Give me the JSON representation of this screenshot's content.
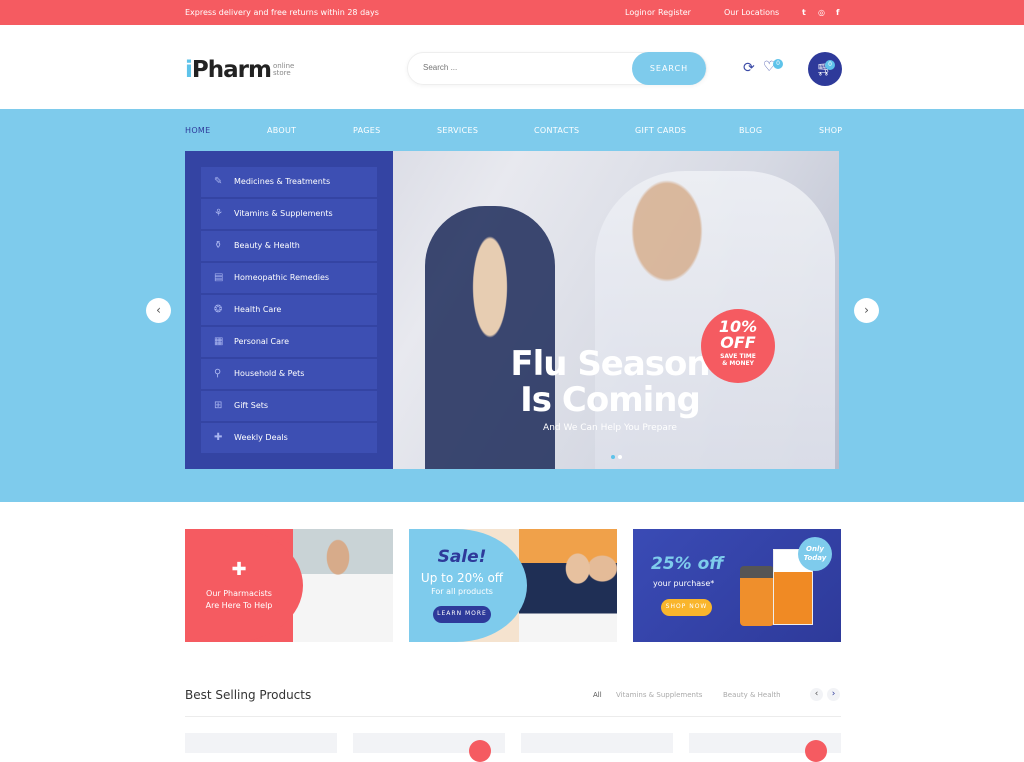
{
  "topbar": {
    "promo": "Express delivery and free returns within 28 days",
    "login": "Login",
    "or": "or",
    "register": "Register",
    "locations": "Our Locations",
    "social": [
      "twitter-icon",
      "instagram-icon",
      "facebook-icon"
    ]
  },
  "header": {
    "logo_i": "i",
    "logo_rest": "Pharm",
    "logo_sub1": "online",
    "logo_sub2": "store",
    "search_placeholder": "Search ...",
    "search_button": "SEARCH",
    "wishlist_count": "0",
    "cart_count": "0"
  },
  "nav": [
    "HOME",
    "ABOUT",
    "PAGES",
    "SERVICES",
    "CONTACTS",
    "GIFT CARDS",
    "BLOG",
    "SHOP"
  ],
  "categories": [
    "Medicines & Treatments",
    "Vitamins & Supplements",
    "Beauty & Health",
    "Homeopathic Remedies",
    "Health Care",
    "Personal Care",
    "Household & Pets",
    "Gift Sets",
    "Weekly Deals"
  ],
  "hero": {
    "title1": "Flu Season",
    "title2": "Is Coming",
    "subtitle": "And We Can Help You Prepare",
    "offer_big1": "10%",
    "offer_big2": "OFF",
    "offer_small1": "SAVE TIME",
    "offer_small2": "& MONEY",
    "slides": 2,
    "active_slide": 1
  },
  "banners": [
    {
      "line1": "Our Pharmacists",
      "line2": "Are Here To Help"
    },
    {
      "title": "Sale!",
      "line1": "Up to 20% off",
      "line2": "For all products",
      "button": "LEARN MORE"
    },
    {
      "title": "25% off",
      "line1": "your purchase*",
      "button": "SHOP NOW",
      "badge1": "Only",
      "badge2": "Today"
    }
  ],
  "products": {
    "title": "Best Selling Products",
    "filters": [
      "All",
      "Vitamins & Supplements",
      "Beauty & Health"
    ]
  },
  "colors": {
    "coral": "#f55b61",
    "sky": "#7ecbec",
    "navy": "#2e3a9a"
  }
}
